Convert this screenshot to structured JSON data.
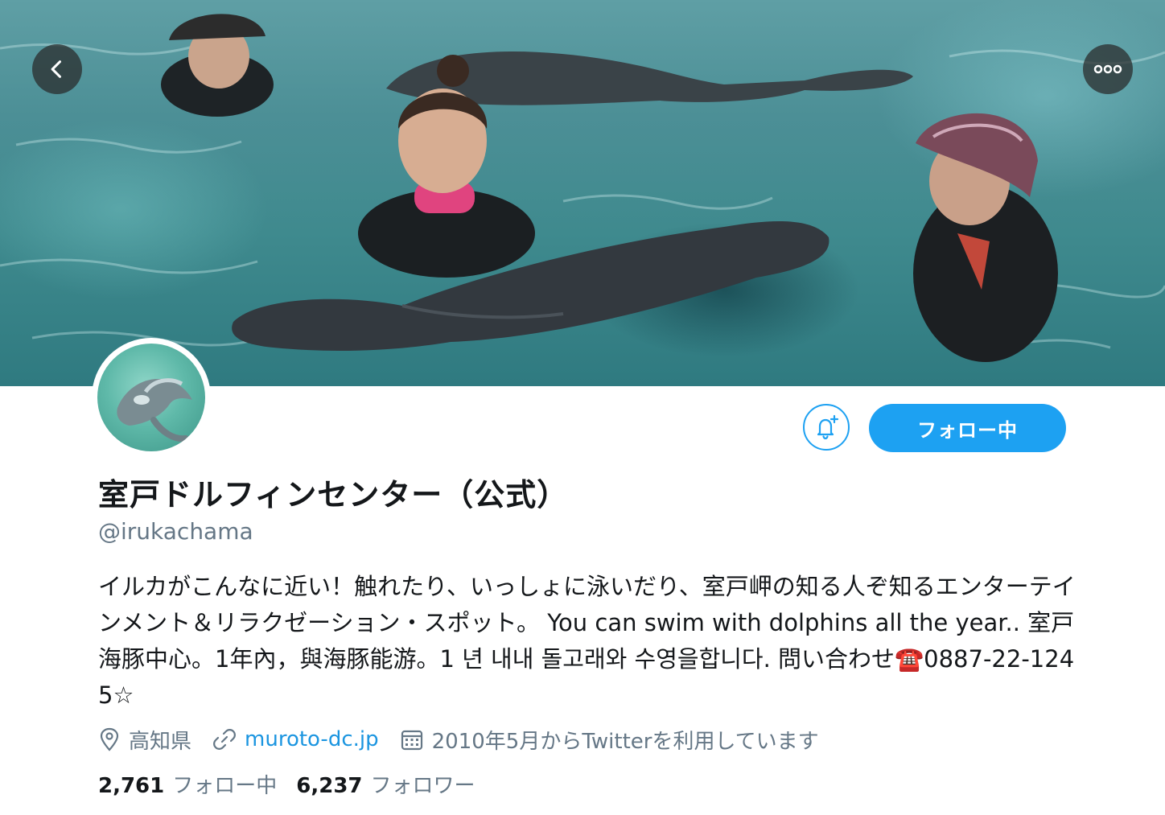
{
  "profile": {
    "name": "室戸ドルフィンセンター（公式）",
    "handle": "@irukachama",
    "bio": "イルカがこんなに近い！触れたり、いっしょに泳いだり、室戸岬の知る人ぞ知るエンターテインメント＆リラクゼーション・スポット。 You can swim with dolphins all the year.. 室戸海豚中心。1年內，與海豚能游。1 년 내내 돌고래와 수영을합니다. 問い合わせ☎️0887-22-1245☆"
  },
  "meta": {
    "location": "高知県",
    "website": "muroto-dc.jp",
    "joined": "2010年5月からTwitterを利用しています"
  },
  "stats": {
    "following_count": "2,761",
    "following_label": "フォロー中",
    "followers_count": "6,237",
    "followers_label": "フォロワー"
  },
  "actions": {
    "follow_label": "フォロー中"
  },
  "icons": {
    "back": "chevron-left-icon",
    "more": "more-horizontal-icon",
    "notify": "bell-plus-icon",
    "location": "location-pin-icon",
    "link": "link-icon",
    "calendar": "calendar-icon"
  },
  "colors": {
    "accent": "#1da1f2",
    "link": "#1b95e0",
    "secondary_text": "#657786",
    "primary_text": "#14171a"
  }
}
